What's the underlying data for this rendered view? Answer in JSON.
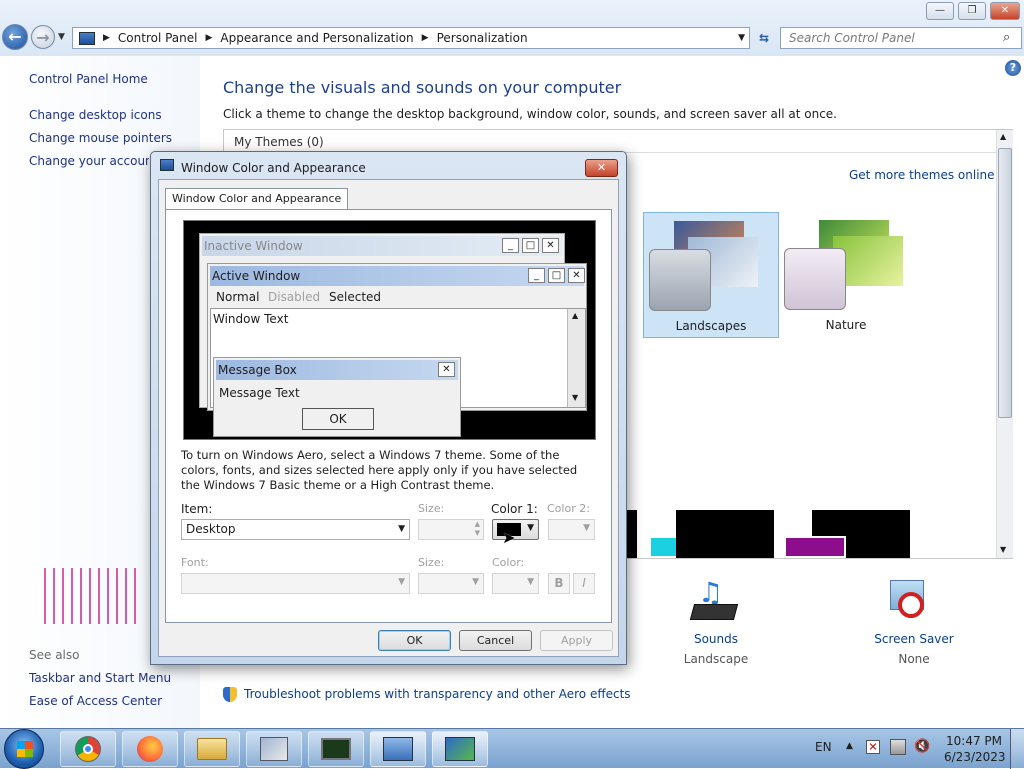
{
  "window": {
    "minimize": "—",
    "restore": "❐",
    "close": "✕"
  },
  "address": {
    "crumbs": [
      "Control Panel",
      "Appearance and Personalization",
      "Personalization"
    ]
  },
  "search": {
    "placeholder": "Search Control Panel"
  },
  "help": "?",
  "sidebar": {
    "home": "Control Panel Home",
    "items": [
      "Change desktop icons",
      "Change mouse pointers",
      "Change your account p"
    ],
    "see_also": "See also",
    "see_also_items": [
      "Taskbar and Start Menu",
      "Ease of Access Center"
    ]
  },
  "main": {
    "title": "Change the visuals and sounds on your computer",
    "subtitle": "Click a theme to change the desktop background, window color, sounds, and screen saver all at once.",
    "my_themes": "My Themes (0)",
    "get_more": "Get more themes online",
    "themes": [
      {
        "label": "Landscapes"
      },
      {
        "label": "Nature"
      }
    ],
    "sounds": {
      "label": "Sounds",
      "value": "Landscape"
    },
    "screensaver": {
      "label": "Screen Saver",
      "value": "None"
    },
    "troubleshoot": "Troubleshoot problems with transparency and other Aero effects"
  },
  "dialog": {
    "title": "Window Color and Appearance",
    "close": "✕",
    "tab": "Window Color and Appearance",
    "preview": {
      "inactive": "Inactive Window",
      "active": "Active Window",
      "menu": [
        "Normal",
        "Disabled",
        "Selected"
      ],
      "window_text": "Window Text",
      "msgbox_title": "Message Box",
      "msgbox_text": "Message Text",
      "msgbox_ok": "OK"
    },
    "info": "To turn on Windows Aero, select a Windows 7 theme.  Some of the colors, fonts, and sizes selected here apply only if you have selected the Windows 7 Basic theme or a High Contrast theme.",
    "item_label": "Item:",
    "item_value": "Desktop",
    "size_label": "Size:",
    "color1_label": "Color 1:",
    "color2_label": "Color 2:",
    "font_label": "Font:",
    "size2_label": "Size:",
    "color_label": "Color:",
    "bold": "B",
    "italic": "I",
    "ok": "OK",
    "cancel": "Cancel",
    "apply": "Apply"
  },
  "taskbar": {
    "lang": "EN",
    "time": "10:47 PM",
    "date": "6/23/2023"
  },
  "colors": {
    "link": "#1e3287",
    "accent_title": "#1c3f94",
    "selection": "#cde4f7",
    "preview_bg": "#000000"
  }
}
